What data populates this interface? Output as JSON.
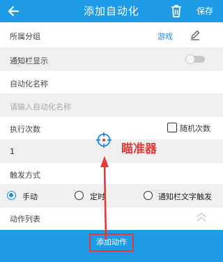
{
  "appbar": {
    "title": "添加自动化",
    "save_label": "保存"
  },
  "group": {
    "label": "所属分组",
    "value": "游戏"
  },
  "notify": {
    "label": "通知栏显示",
    "enabled": false
  },
  "name": {
    "label": "自动化名称",
    "placeholder": "请输入自动化名称"
  },
  "exec": {
    "label": "执行次数",
    "random_label": "随机次数",
    "random_checked": false,
    "count": "1"
  },
  "trigger": {
    "label": "触发方式",
    "options": [
      {
        "label": "手动",
        "selected": true
      },
      {
        "label": "定时",
        "selected": false
      },
      {
        "label": "通知栏文字触发",
        "selected": false
      }
    ]
  },
  "actions": {
    "label": "动作列表",
    "add_label": "添加动作"
  },
  "annotation": {
    "reticle_text": "瞄准器"
  },
  "colors": {
    "accent": "#1e9be6",
    "annotation": "#e53935",
    "link": "#1e88e5"
  }
}
